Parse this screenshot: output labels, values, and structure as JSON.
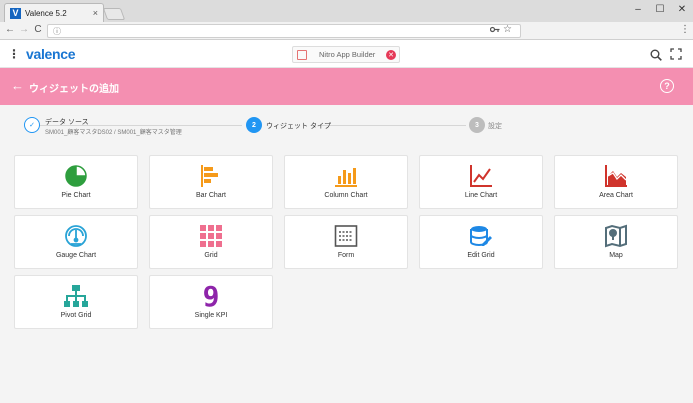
{
  "browser": {
    "tab_title": "Valence 5.2",
    "tab_close": "×",
    "favicon_letter": "V",
    "controls": [
      "–",
      "☐",
      "✕"
    ],
    "nav": [
      "←",
      "→",
      "C"
    ],
    "url_icon": "ⓘ",
    "url": ""
  },
  "app": {
    "kebab": "⋮",
    "logo": "valence",
    "nitro_label": "Nitro App Builder",
    "nitro_close": "✕",
    "expand": "⛶"
  },
  "titlebar": {
    "back": "←",
    "title": "ウィジェットの追加",
    "help": "?"
  },
  "stepper": {
    "steps": [
      {
        "marker": "✓",
        "label": "データ ソース",
        "sub": "SM001_顧客マスタDS02 / SM001_顧客マスタ管理",
        "state": "done"
      },
      {
        "marker": "2",
        "label": "ウィジェット タイプ",
        "state": "active"
      },
      {
        "marker": "3",
        "label": "設定",
        "state": "pending"
      }
    ]
  },
  "widgets": [
    {
      "label": "Pie Chart",
      "icon": "pie-chart-icon",
      "color": "#2e9e3e"
    },
    {
      "label": "Bar Chart",
      "icon": "bar-chart-icon",
      "color": "#f59a1a"
    },
    {
      "label": "Column Chart",
      "icon": "column-chart-icon",
      "color": "#f59a1a"
    },
    {
      "label": "Line Chart",
      "icon": "line-chart-icon",
      "color": "#d0342c"
    },
    {
      "label": "Area Chart",
      "icon": "area-chart-icon",
      "color": "#d0342c"
    },
    {
      "label": "Gauge Chart",
      "icon": "gauge-icon",
      "color": "#29a3d6"
    },
    {
      "label": "Grid",
      "icon": "grid-icon",
      "color": "#ef6f8f"
    },
    {
      "label": "Form",
      "icon": "form-icon",
      "color": "#555555"
    },
    {
      "label": "Edit Grid",
      "icon": "edit-grid-icon",
      "color": "#1e88e5"
    },
    {
      "label": "Map",
      "icon": "map-icon",
      "color": "#546e7a"
    },
    {
      "label": "Pivot Grid",
      "icon": "pivot-grid-icon",
      "color": "#26a69a"
    },
    {
      "label": "Single KPI",
      "icon": "single-kpi-icon",
      "color": "#8e24aa",
      "glyph": "9"
    }
  ],
  "colors": {
    "accent": "#f48fb1",
    "step_active": "#2196f3",
    "step_pending": "#bdbdbd",
    "logo": "#1976d2"
  }
}
